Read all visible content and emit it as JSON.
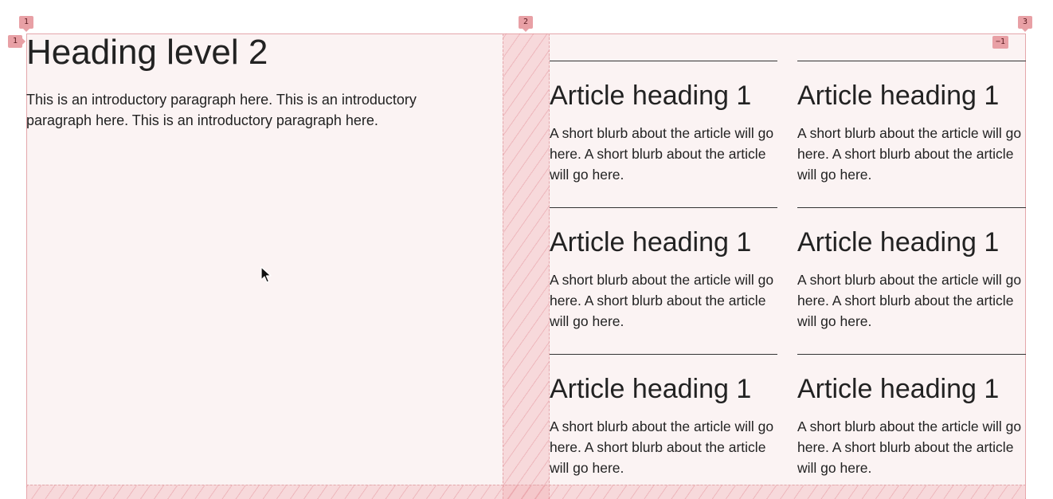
{
  "overlay": {
    "column_line_numbers": [
      "1",
      "2",
      "3"
    ],
    "row_line_numbers": [
      "1"
    ],
    "end_line_number": "−1",
    "colors": {
      "badge": "#e8a0a5",
      "outline": "#e4a7ab",
      "container_bg": "#fbf3f3"
    }
  },
  "intro": {
    "heading": "Heading level 2",
    "paragraph": "This is an introductory paragraph here. This is an introductory paragraph here. This is an introductory paragraph here."
  },
  "articles": [
    {
      "heading": "Article heading 1",
      "blurb": "A short blurb about the article will go here. A short blurb about the article will go here."
    },
    {
      "heading": "Article heading 1",
      "blurb": "A short blurb about the article will go here. A short blurb about the article will go here."
    },
    {
      "heading": "Article heading 1",
      "blurb": "A short blurb about the article will go here. A short blurb about the article will go here."
    },
    {
      "heading": "Article heading 1",
      "blurb": "A short blurb about the article will go here. A short blurb about the article will go here."
    },
    {
      "heading": "Article heading 1",
      "blurb": "A short blurb about the article will go here. A short blurb about the article will go here."
    },
    {
      "heading": "Article heading 1",
      "blurb": "A short blurb about the article will go here. A short blurb about the article will go here."
    }
  ],
  "cursor": {
    "icon": "arrow-pointer-icon"
  }
}
